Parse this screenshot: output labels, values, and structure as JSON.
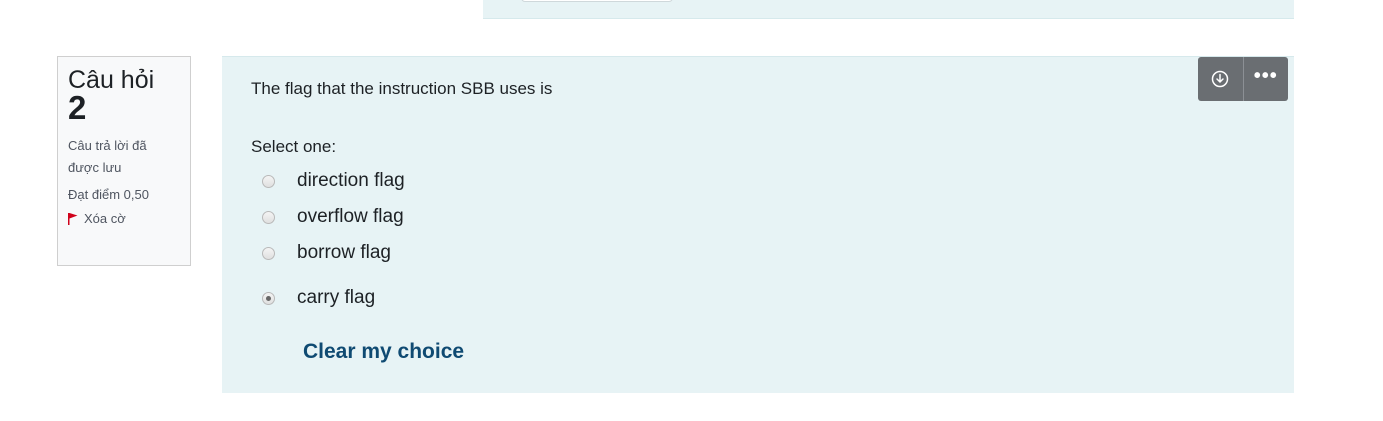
{
  "question_info": {
    "label": "Câu hỏi",
    "number": "2",
    "state": "Câu trả lời đã được lưu",
    "grade": "Đạt điểm 0,50",
    "flag_label": "Xóa cờ",
    "flag_icon": "flag-icon",
    "flag_color": "#d0021b"
  },
  "question": {
    "text": "The flag that the instruction SBB uses is",
    "prompt": "Select one:",
    "options": [
      {
        "label": "direction flag",
        "selected": false
      },
      {
        "label": "overflow flag",
        "selected": false
      },
      {
        "label": "borrow flag",
        "selected": false
      },
      {
        "label": "carry flag",
        "selected": true
      }
    ],
    "clear_label": "Clear my choice"
  },
  "actions": {
    "download_icon": "download-circle-icon",
    "more_icon": "more-dots-icon",
    "more_label": "•••"
  },
  "colors": {
    "panel_bg": "#e7f3f5",
    "link": "#0f4a72",
    "action_bg": "#6a6e72"
  }
}
